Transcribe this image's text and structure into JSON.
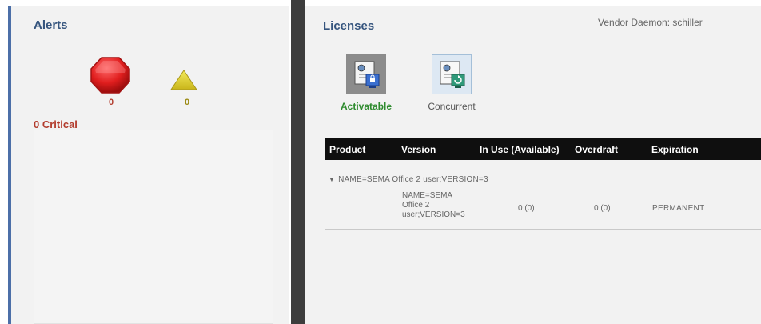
{
  "alerts": {
    "title": "Alerts",
    "critical_count": "0",
    "warning_count": "0",
    "critical_label": "0 Critical"
  },
  "licenses": {
    "title": "Licenses",
    "vendor_daemon": "Vendor Daemon: schiller",
    "types": {
      "activatable": "Activatable",
      "concurrent": "Concurrent"
    },
    "columns": {
      "product": "Product",
      "version": "Version",
      "in_use": "In Use (Available)",
      "overdraft": "Overdraft",
      "expiration": "Expiration"
    },
    "group": {
      "label": "NAME=SEMA Office 2 user;VERSION=3",
      "rows": [
        {
          "version_lines": [
            "NAME=SEMA",
            "Office 2",
            "user;VERSION=3"
          ],
          "in_use": "0 (0)",
          "overdraft": "0 (0)",
          "expiration": "PERMANENT"
        }
      ]
    }
  },
  "colors": {
    "panel_title": "#36557e",
    "critical": "#b23b2c",
    "activatable": "#2e8b2e",
    "panel_border": "#4c6fa8"
  }
}
